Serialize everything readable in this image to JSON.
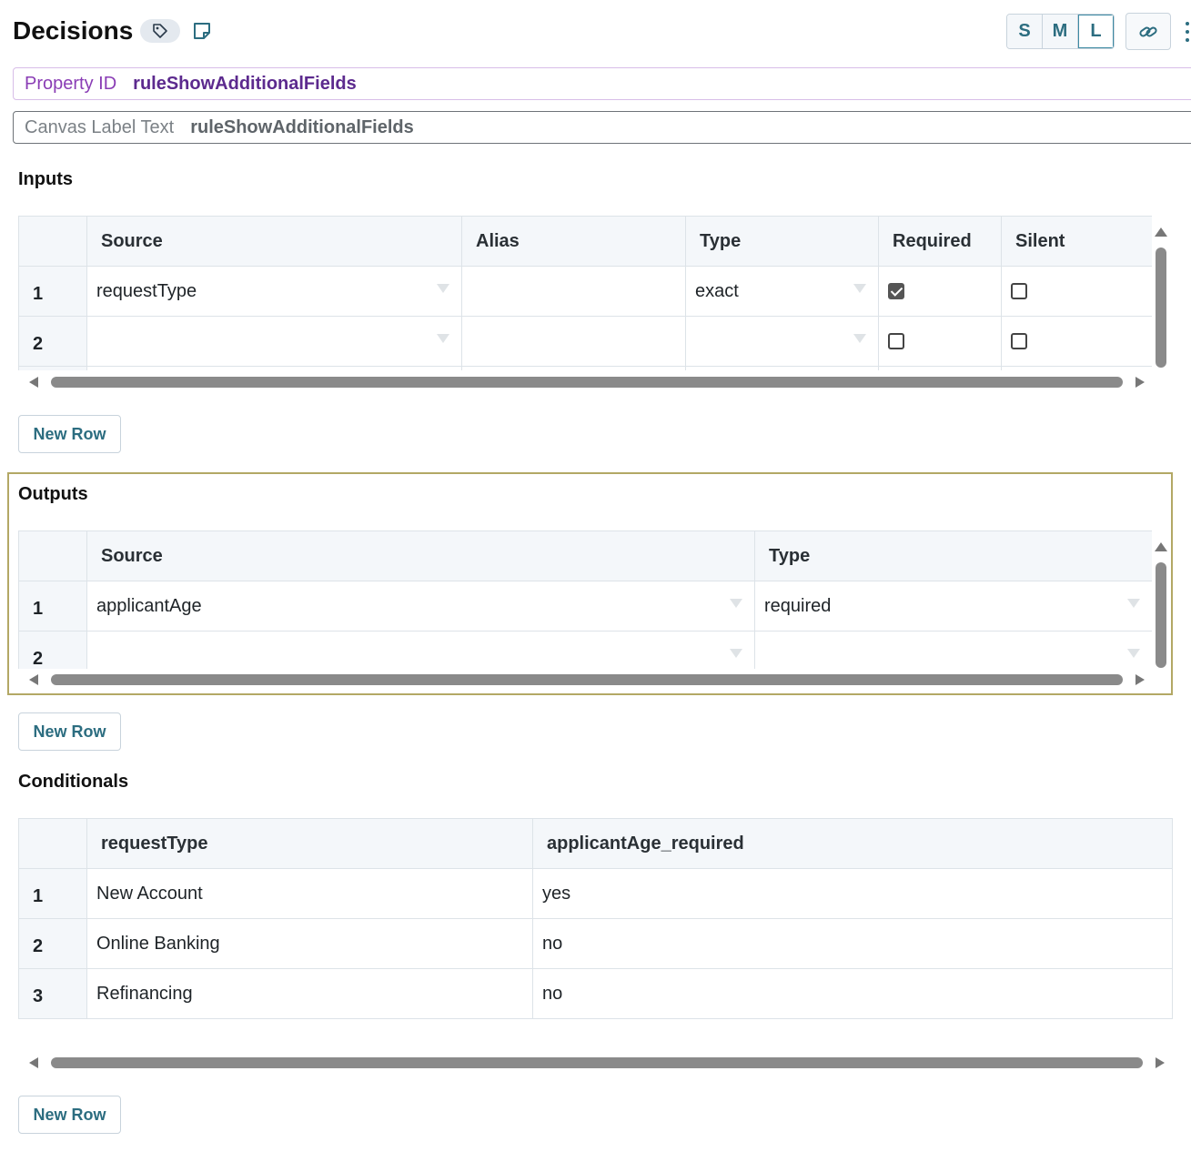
{
  "header": {
    "title": "Decisions",
    "tag_icon": "tag-icon",
    "note_icon": "note-icon",
    "sizes": [
      "S",
      "M",
      "L"
    ],
    "active_size": "L",
    "link_icon": "link-icon",
    "more_icon": "kebab-menu-icon"
  },
  "property_id": {
    "label": "Property ID",
    "value": "ruleShowAdditionalFields"
  },
  "canvas_label": {
    "label": "Canvas Label Text",
    "value": "ruleShowAdditionalFields"
  },
  "inputs": {
    "title": "Inputs",
    "columns": [
      "Source",
      "Alias",
      "Type",
      "Required",
      "Silent"
    ],
    "rows": [
      {
        "num": "1",
        "source": "requestType",
        "alias": "",
        "type": "exact",
        "required": true,
        "silent": false
      },
      {
        "num": "2",
        "source": "",
        "alias": "",
        "type": "",
        "required": false,
        "silent": false
      }
    ],
    "new_row_label": "New Row"
  },
  "outputs": {
    "title": "Outputs",
    "columns": [
      "Source",
      "Type"
    ],
    "rows": [
      {
        "num": "1",
        "source": "applicantAge",
        "type": "required"
      },
      {
        "num": "2",
        "source": "",
        "type": ""
      }
    ],
    "new_row_label": "New Row"
  },
  "conditionals": {
    "title": "Conditionals",
    "columns": [
      "requestType",
      "applicantAge_required"
    ],
    "rows": [
      {
        "num": "1",
        "c1": "New Account",
        "c2": "yes"
      },
      {
        "num": "2",
        "c1": "Online Banking",
        "c2": "no"
      },
      {
        "num": "3",
        "c1": "Refinancing",
        "c2": "no"
      }
    ],
    "new_row_label": "New Row"
  },
  "colors": {
    "accent": "#2c6d80",
    "property_id": "#5c2a8e",
    "highlight_border": "#b3a865"
  }
}
